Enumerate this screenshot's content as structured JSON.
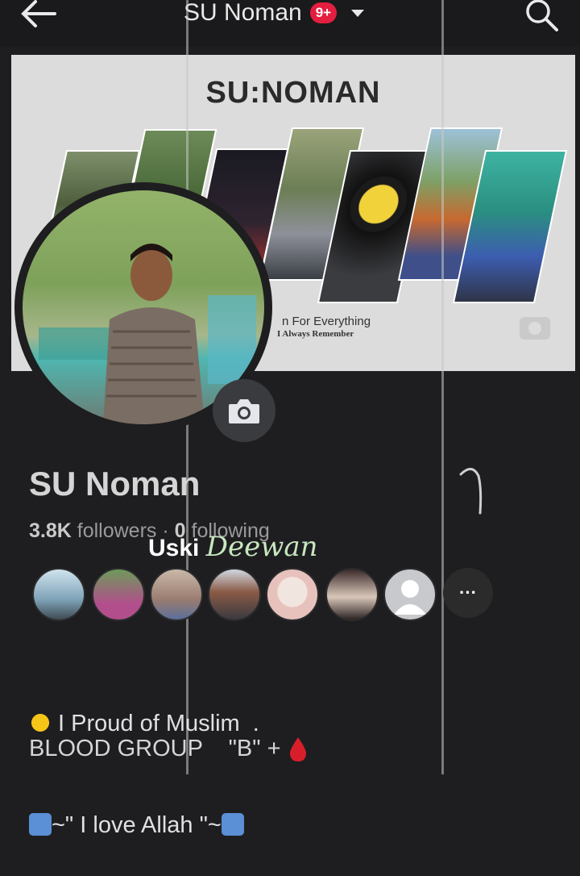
{
  "topbar": {
    "title": "SU Noman",
    "badge": "9+",
    "back_icon": "arrow-left-icon",
    "search_icon": "search-icon"
  },
  "cover": {
    "logo_text": "SU:NOMAN",
    "tagline": "n For Everything",
    "subtagline": "I Always Remember"
  },
  "profile": {
    "name": "SU Noman",
    "followers_count": "3.8K",
    "followers_label": "followers",
    "separator": "·",
    "following_count": "0",
    "following_label": "following"
  },
  "watermark": {
    "word1": "Uski",
    "word2": "Deewan"
  },
  "friends": {
    "more_label": "···"
  },
  "bio": {
    "line1": " I Proud of Muslim  .",
    "line2": "~\" I love Allah \"~"
  },
  "blood": {
    "label": "BLOOD GROUP",
    "value": "\"B\" +"
  },
  "colors": {
    "badge": "#e41e3f",
    "background": "#1e1e20",
    "accent_text": "#e4e6eb"
  }
}
